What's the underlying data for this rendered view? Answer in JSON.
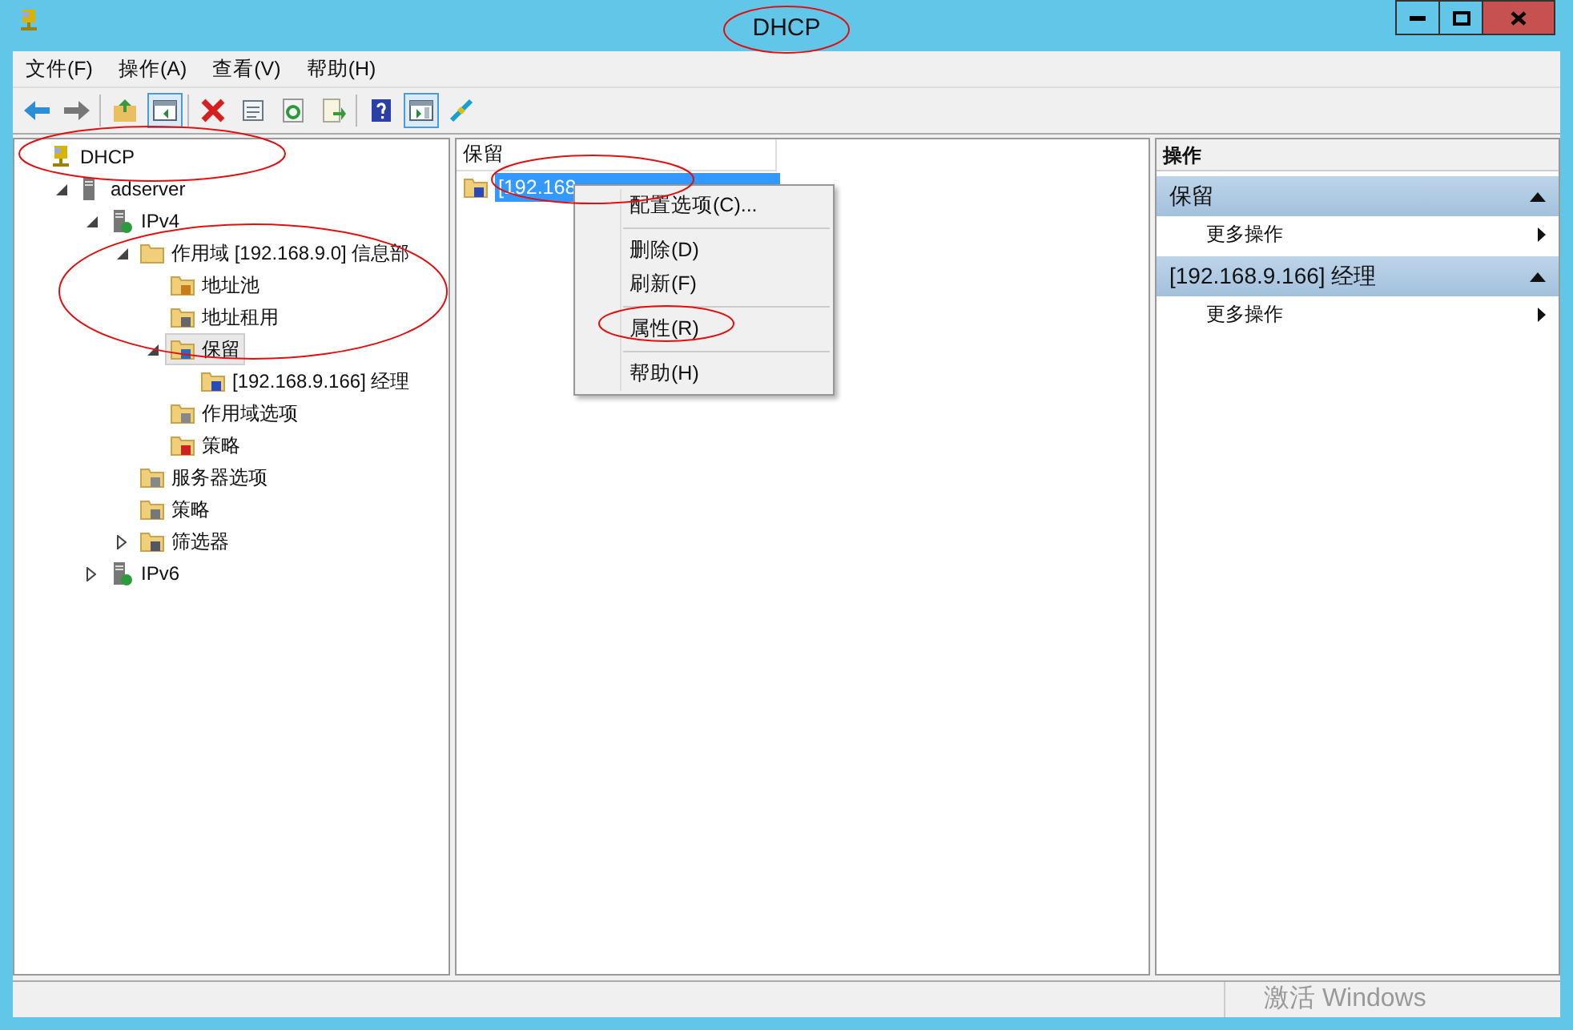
{
  "window": {
    "title": "DHCP",
    "controls": [
      {
        "kind": "minimize"
      },
      {
        "kind": "maximize"
      },
      {
        "kind": "close"
      }
    ]
  },
  "menu": [
    "文件(F)",
    "操作(A)",
    "查看(V)",
    "帮助(H)"
  ],
  "toolbar": [
    {
      "kind": "back",
      "pressed": false
    },
    {
      "kind": "forward",
      "pressed": false
    },
    {
      "kind": "up",
      "pressed": false
    },
    {
      "kind": "tree",
      "pressed": true
    },
    {
      "kind": "delete",
      "pressed": false
    },
    {
      "kind": "properties",
      "pressed": false
    },
    {
      "kind": "refresh",
      "pressed": false
    },
    {
      "kind": "export",
      "pressed": false
    },
    {
      "kind": "help",
      "pressed": false
    },
    {
      "kind": "actionpane",
      "pressed": true
    },
    {
      "kind": "plugin",
      "pressed": false
    }
  ],
  "tree": [
    {
      "label": "DHCP",
      "kind": "root",
      "selected": false,
      "children": [
        {
          "label": "adserver",
          "kind": "server",
          "expanded": true,
          "selected": false,
          "children": [
            {
              "label": "IPv4",
              "kind": "ip",
              "expanded": true,
              "selected": false,
              "children": [
                {
                  "label": "作用域 [192.168.9.0] 信息部",
                  "kind": "folder",
                  "expanded": true,
                  "selected": false,
                  "children": [
                    {
                      "label": "地址池",
                      "kind": "pool",
                      "selected": false
                    },
                    {
                      "label": "地址租用",
                      "kind": "lease",
                      "selected": false
                    },
                    {
                      "label": "保留",
                      "kind": "reserve",
                      "expanded": true,
                      "selected": true,
                      "children": [
                        {
                          "label": "[192.168.9.166] 经理",
                          "kind": "host",
                          "selected": false
                        }
                      ]
                    },
                    {
                      "label": "作用域选项",
                      "kind": "options",
                      "selected": false
                    },
                    {
                      "label": "策略",
                      "kind": "policy",
                      "selected": false
                    }
                  ]
                },
                {
                  "label": "服务器选项",
                  "kind": "options",
                  "selected": false
                },
                {
                  "label": "策略",
                  "kind": "policy2",
                  "selected": false
                },
                {
                  "label": "筛选器",
                  "kind": "filter",
                  "expanded": false,
                  "selected": false
                }
              ]
            },
            {
              "label": "IPv6",
              "kind": "ip",
              "expanded": false,
              "selected": false
            }
          ]
        }
      ]
    }
  ],
  "list": {
    "column": "保留",
    "rows": [
      {
        "label": "[192.168",
        "selected": true
      }
    ]
  },
  "context_menu": {
    "groups": [
      [
        "配置选项(C)..."
      ],
      [
        "删除(D)",
        "刷新(F)"
      ],
      [
        "属性(R)"
      ],
      [
        "帮助(H)"
      ]
    ]
  },
  "actions": {
    "title": "操作",
    "sections": [
      {
        "title": "保留",
        "expanded": true,
        "items": [
          "更多操作"
        ]
      },
      {
        "title": "[192.168.9.166] 经理",
        "expanded": true,
        "items": [
          "更多操作"
        ]
      }
    ]
  },
  "status_bar": {
    "text": "激活 Windows"
  }
}
